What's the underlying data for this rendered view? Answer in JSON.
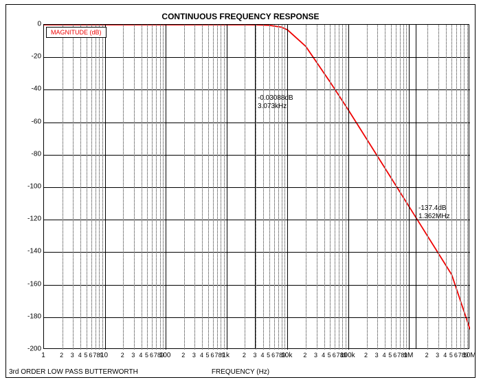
{
  "title": "CONTINUOUS FREQUENCY RESPONSE",
  "legend": "MAGNITUDE (dB)",
  "xlabel": "FREQUENCY (Hz)",
  "note": "3rd ORDER LOW PASS BUTTERWORTH",
  "annot1_line1": "-0.03088dB",
  "annot1_line2": "3.073kHz",
  "annot2_line1": "-137.4dB",
  "annot2_line2": "1.362MHz",
  "yticks": {
    "0": "0",
    "1": "-20",
    "2": "-40",
    "3": "-60",
    "4": "-80",
    "5": "-100",
    "6": "-120",
    "7": "-140",
    "8": "-160",
    "9": "-180",
    "10": "-200"
  },
  "xmajors": {
    "0": "1",
    "1": "10",
    "2": "100",
    "3": "1k",
    "4": "10k",
    "5": "100k",
    "6": "1M",
    "7": "10M"
  },
  "xminors": {
    "0": "2",
    "1": "3",
    "2": "4",
    "3": "5",
    "4": "6",
    "5": "7",
    "6": "8",
    "7": "9"
  },
  "chart_data": {
    "type": "line",
    "title": "CONTINUOUS FREQUENCY RESPONSE",
    "xlabel": "FREQUENCY (Hz)",
    "ylabel": "MAGNITUDE (dB)",
    "xscale": "log",
    "xlim": [
      1,
      10000000
    ],
    "ylim": [
      -200,
      0
    ],
    "series": [
      {
        "name": "3rd ORDER LOW PASS BUTTERWORTH",
        "color": "#ee0000",
        "x": [
          1,
          10,
          100,
          500,
          1000,
          2000,
          3073,
          5000,
          8000,
          10000,
          20000,
          50000,
          100000,
          200000,
          500000,
          1000000,
          1362000,
          2000000,
          5000000,
          10000000
        ],
        "y": [
          0,
          0,
          0,
          0,
          -0.001,
          -0.01,
          -0.031,
          -0.3,
          -1.5,
          -3.1,
          -13.3,
          -35.1,
          -52.4,
          -70.3,
          -94.0,
          -112.0,
          -120.0,
          -130.0,
          -153.8,
          -187.5
        ]
      }
    ],
    "markers": [
      {
        "x": 3073,
        "y": -0.03088,
        "label": "-0.03088dB 3.073kHz"
      },
      {
        "x": 1362000,
        "y": -137.4,
        "label": "-137.4dB 1.362MHz"
      }
    ]
  }
}
